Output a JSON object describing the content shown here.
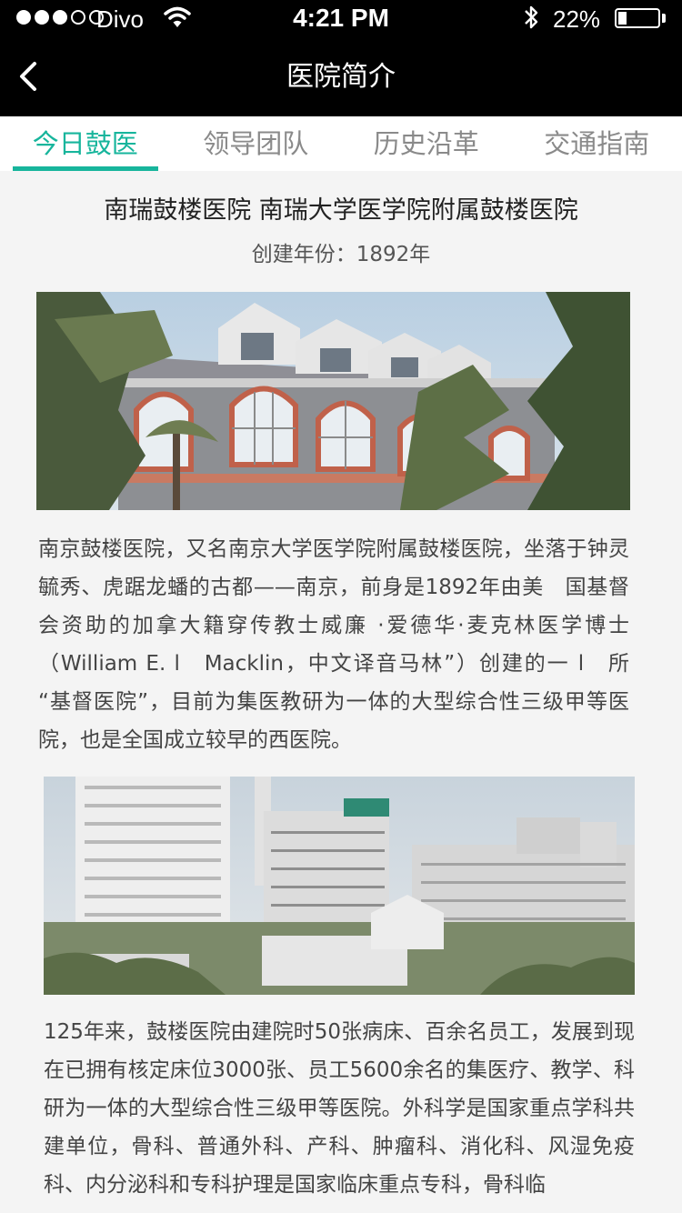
{
  "status_bar": {
    "carrier": "Divo",
    "time": "4:21 PM",
    "battery_percent_label": "22%",
    "battery_level": 0.22
  },
  "nav": {
    "title": "医院简介",
    "back_icon": "chevron-left-icon"
  },
  "tabs": [
    {
      "label": "今日鼓医",
      "active": true
    },
    {
      "label": "领导团队",
      "active": false
    },
    {
      "label": "历史沿革",
      "active": false
    },
    {
      "label": "交通指南",
      "active": false
    }
  ],
  "content": {
    "title": "南瑞鼓楼医院  南瑞大学医学院附属鼓楼医院",
    "founded_label": "创建年份：",
    "founded_year": "1892年",
    "paragraph1": "南京鼓楼医院，又名南京大学医学院附属鼓楼医院，坐落于钟灵毓秀、虎踞龙蟠的古都——南京，前身是1892年由美　国基督会资助的加拿大籍穿传教士威廉 ·爱德华·麦克林医学博士（William E. l　Macklin，中文译音马林”）创建的一 l　所 “基督医院”，目前为集医教研为一体的大型综合性三级甲等医院，也是全国成立较早的西医院。",
    "paragraph2": "125年来，鼓楼医院由建院时50张病床、百余名员工，发展到现在已拥有核定床位3000张、员工5600余名的集医疗、教学、科研为一体的大型综合性三级甲等医院。外科学是国家重点学科共建单位，骨科、普通外科、产科、肿瘤科、消化科、风湿免疫科、内分泌科和专科护理是国家临床重点专科，骨科临"
  },
  "colors": {
    "accent": "#17b59c",
    "bar_bg": "#000000",
    "page_bg": "#f4f4f4"
  }
}
